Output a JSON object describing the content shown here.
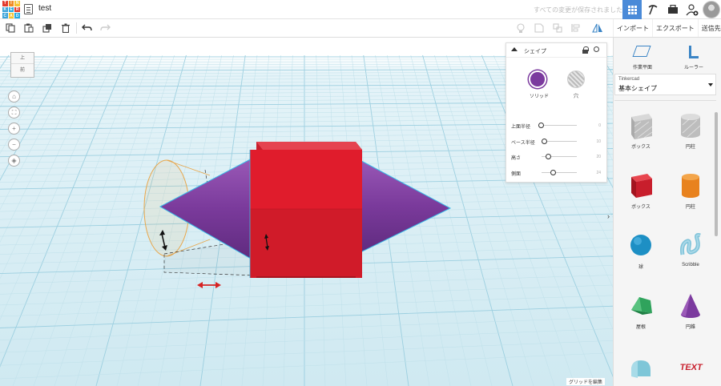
{
  "app": {
    "logo_letters": [
      "T",
      "I",
      "N",
      "K",
      "E",
      "R",
      "C",
      "A",
      "D"
    ],
    "logo_colors": [
      "#e23b2e",
      "#f08a24",
      "#f6c331",
      "#3aa3d9",
      "#27a9e1",
      "#e23b2e",
      "#3aa3d9",
      "#f6c331",
      "#27a9e1"
    ],
    "doc_title": "test",
    "saved_status": "すべての変更が保存されました",
    "accent": "#4a8ad8"
  },
  "toolbar": {
    "left_tools": [
      "copy-icon",
      "paste-icon",
      "duplicate-icon",
      "delete-icon",
      "undo-icon",
      "redo-icon"
    ],
    "right_tools": [
      "note-icon",
      "align-icon",
      "group-icon",
      "ungroup-icon",
      "mirror-icon"
    ]
  },
  "actions": {
    "import": "インポート",
    "export": "エクスポート",
    "send": "送信先"
  },
  "viewcube": {
    "top": "上",
    "front": "前"
  },
  "workplane": {
    "grid_edit": "グリッドを編集"
  },
  "inspector": {
    "title": "シェイプ",
    "solid_label": "ソリッド",
    "hole_label": "穴",
    "solid_color": "#7b3a9e",
    "props": [
      {
        "label": "上面半径",
        "value": "0",
        "level": 0.0
      },
      {
        "label": "ベース半径",
        "value": "10",
        "level": 0.1
      },
      {
        "label": "高さ",
        "value": "20",
        "level": 0.2
      },
      {
        "label": "側面",
        "value": "24",
        "level": 0.33
      }
    ]
  },
  "panel": {
    "workplane_label": "作業平面",
    "ruler_label": "ルーラー",
    "library_brand": "Tinkercad",
    "library_category": "基本シェイプ",
    "shapes": [
      {
        "name": "ボックス",
        "icon": "box-hole-icon"
      },
      {
        "name": "円柱",
        "icon": "cylinder-hole-icon"
      },
      {
        "name": "ボックス",
        "icon": "box-icon"
      },
      {
        "name": "円柱",
        "icon": "cylinder-icon"
      },
      {
        "name": "球",
        "icon": "sphere-icon"
      },
      {
        "name": "Scribble",
        "icon": "scribble-icon"
      },
      {
        "name": "屋根",
        "icon": "roof-icon"
      },
      {
        "name": "円錐",
        "icon": "cone-icon"
      },
      {
        "name": "",
        "icon": "round-roof-icon"
      },
      {
        "name": "",
        "icon": "text-icon"
      }
    ]
  }
}
